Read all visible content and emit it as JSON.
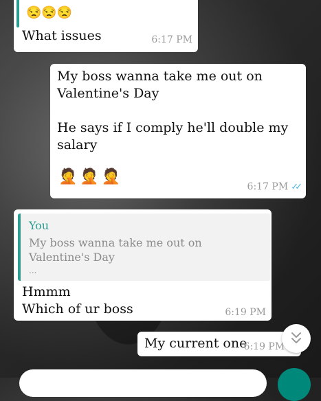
{
  "messages": [
    {
      "emoji": "😒😒😒",
      "text": "What issues",
      "time": "6:17 PM"
    },
    {
      "text": "My boss wanna take me out on\nValentine's Day\n\nHe says if I comply he'll double my\nsalary",
      "emoji": "🤦🤦🤦",
      "time": "6:17 PM"
    },
    {
      "quote_author": "You",
      "quote_text": "My boss wanna take me out on\nValentine's Day",
      "quote_more": "...",
      "text": "Hmmm\nWhich of ur boss",
      "time": "6:19 PM"
    },
    {
      "text": "My current one",
      "time": "6:19 PM"
    }
  ],
  "colors": {
    "quote_author": "#2a9d8f",
    "read_ticks": "#4fb6ec"
  },
  "icons": {
    "scroll_down": "chevron-double-down-icon",
    "read_receipt": "double-check-icon"
  }
}
